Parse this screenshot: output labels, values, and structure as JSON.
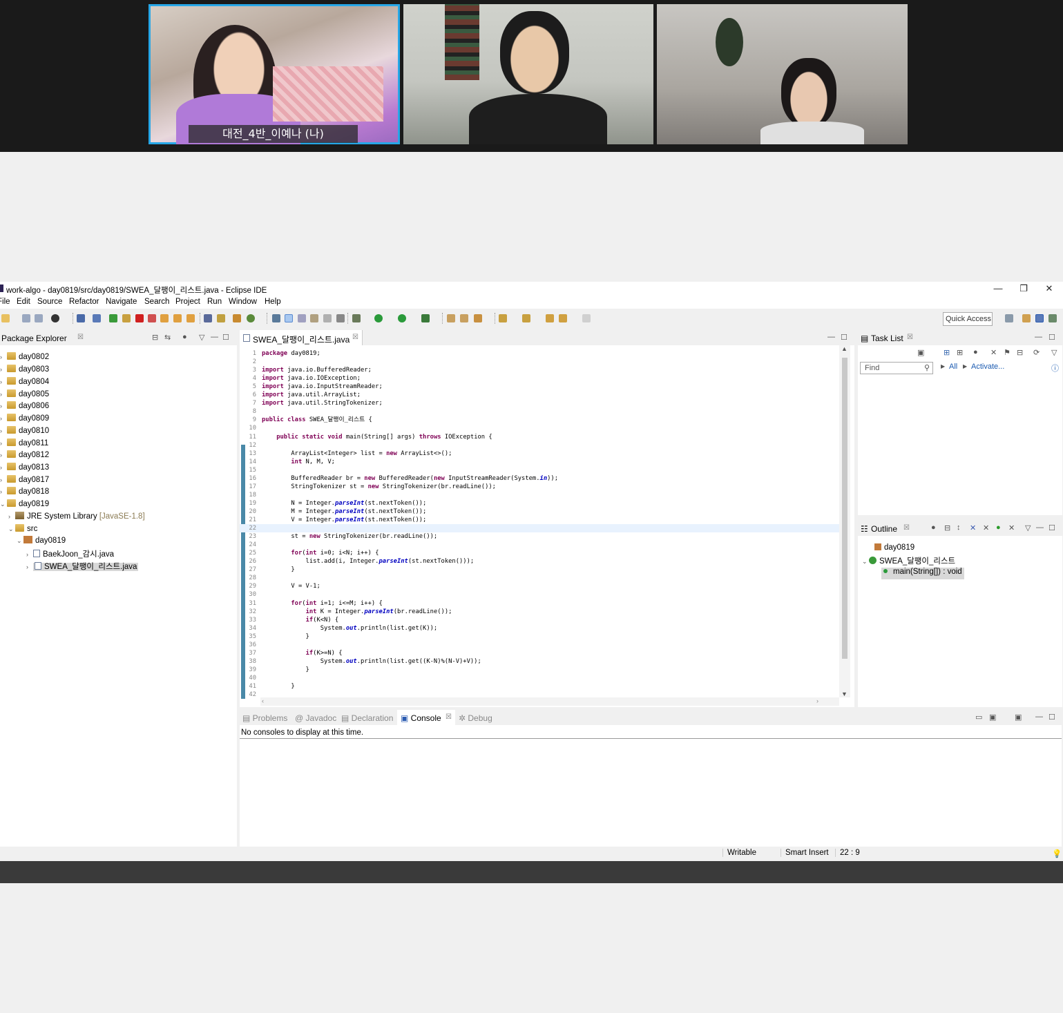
{
  "video_call": {
    "participants": [
      {
        "name": "대전_4반_이예나 (나)",
        "active": true
      },
      {
        "name": "",
        "active": false
      },
      {
        "name": "",
        "active": false
      }
    ]
  },
  "window": {
    "title": "work-algo - day0819/src/day0819/SWEA_달팽이_리스트.java - Eclipse IDE",
    "controls": {
      "minimize": "—",
      "maximize": "❐",
      "close": "✕"
    }
  },
  "menu": [
    "File",
    "Edit",
    "Source",
    "Refactor",
    "Navigate",
    "Search",
    "Project",
    "Run",
    "Window",
    "Help"
  ],
  "toolbar": {
    "quick_access": "Quick Access"
  },
  "package_explorer": {
    "title": "Package Explorer",
    "projects": [
      "day0802",
      "day0803",
      "day0804",
      "day0805",
      "day0806",
      "day0809",
      "day0810",
      "day0811",
      "day0812",
      "day0813",
      "day0817",
      "day0818",
      "day0819"
    ],
    "expanded": {
      "jre": "JRE System Library",
      "jre_version": "[JavaSE-1.8]",
      "src": "src",
      "package": "day0819",
      "files": [
        "BaekJoon_감시.java",
        "SWEA_달팽이_리스트.java"
      ]
    }
  },
  "editor": {
    "tab": "SWEA_달팽이_리스트.java",
    "cursor_line": 22,
    "lines": [
      "package day0819;",
      "",
      "import java.io.BufferedReader;",
      "import java.io.IOException;",
      "import java.io.InputStreamReader;",
      "import java.util.ArrayList;",
      "import java.util.StringTokenizer;",
      "",
      "public class SWEA_달팽이_리스트 {",
      "",
      "    public static void main(String[] args) throws IOException {",
      "",
      "        ArrayList<Integer> list = new ArrayList<>();",
      "        int N, M, V;",
      "",
      "        BufferedReader br = new BufferedReader(new InputStreamReader(System.in));",
      "        StringTokenizer st = new StringTokenizer(br.readLine());",
      "",
      "        N = Integer.parseInt(st.nextToken());",
      "        M = Integer.parseInt(st.nextToken());",
      "        V = Integer.parseInt(st.nextToken());",
      "        ",
      "        st = new StringTokenizer(br.readLine());",
      "",
      "        for(int i=0; i<N; i++) {",
      "            list.add(i, Integer.parseInt(st.nextToken()));",
      "        }",
      "",
      "        V = V-1;",
      "",
      "        for(int i=1; i<=M; i++) {",
      "            int K = Integer.parseInt(br.readLine());",
      "            if(K<N) {",
      "                System.out.println(list.get(K));",
      "            }",
      "",
      "            if(K>=N) {",
      "                System.out.println(list.get((K-N)%(N-V)+V));",
      "            }",
      "",
      "        }",
      ""
    ]
  },
  "task_list": {
    "title": "Task List",
    "find_placeholder": "Find",
    "all_label": "All",
    "activate_label": "Activate..."
  },
  "outline": {
    "title": "Outline",
    "package": "day0819",
    "class": "SWEA_달팽이_리스트",
    "method": "main(String[]) : void"
  },
  "bottom_panel": {
    "tabs": [
      "Problems",
      "Javadoc",
      "Declaration",
      "Console",
      "Debug"
    ],
    "active_tab": "Console",
    "message": "No consoles to display at this time."
  },
  "status": {
    "writable": "Writable",
    "insert_mode": "Smart Insert",
    "position": "22 : 9"
  }
}
